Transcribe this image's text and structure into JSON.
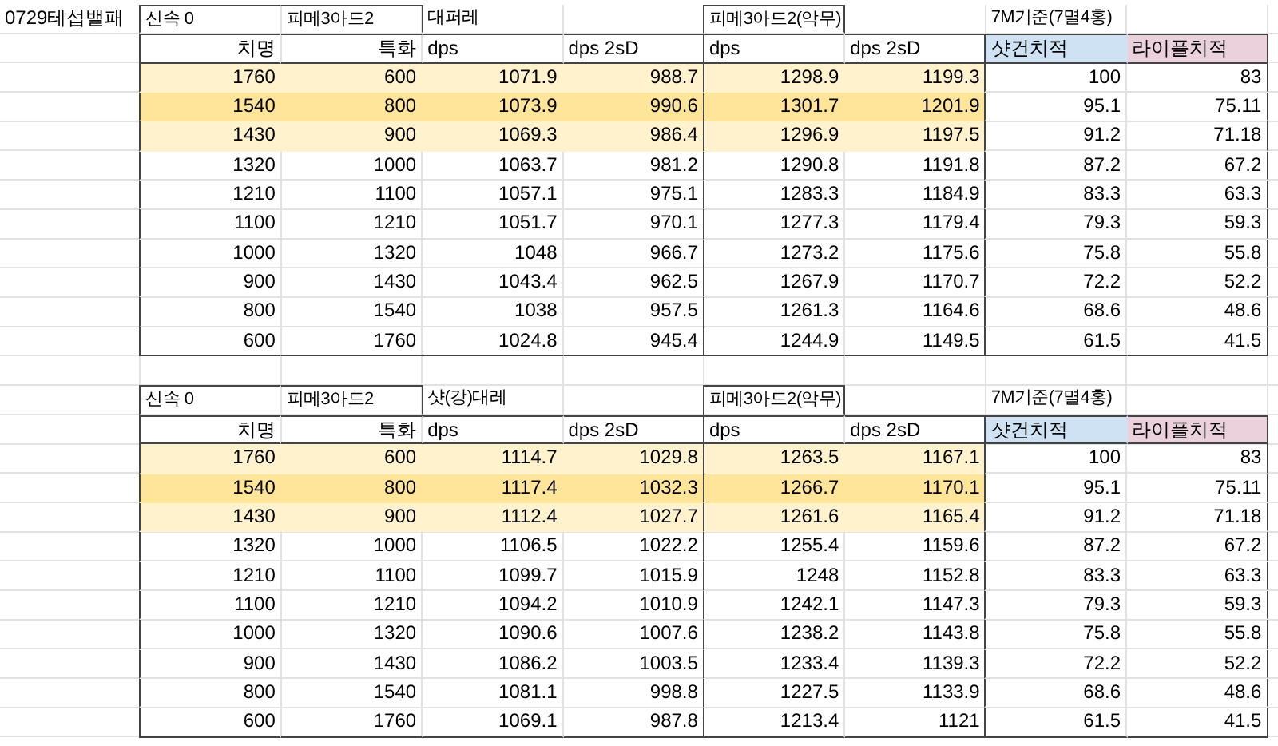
{
  "sheet_title": "0729테섭밸패",
  "tables": [
    {
      "columns": [
        {
          "label": "치명",
          "kind": "stat",
          "group": "신속 0"
        },
        {
          "label": "특화",
          "kind": "stat",
          "group": "피메3아드2"
        },
        {
          "label": "dps",
          "kind": "value",
          "group": "대퍼레"
        },
        {
          "label": "dps 2sD",
          "kind": "value"
        },
        {
          "label": "dps",
          "kind": "value",
          "group": "피메3아드2(악무)"
        },
        {
          "label": "dps 2sD",
          "kind": "value"
        },
        {
          "label": "샷건치적",
          "kind": "value",
          "group": "7M기준(7멸4홍)",
          "color": "#cfe2f3"
        },
        {
          "label": "라이플치적",
          "kind": "value",
          "color": "#ead1dc"
        }
      ],
      "rows": [
        {
          "color": "#fff2cc",
          "cells": [
            "1760",
            "600",
            "1071.9",
            "988.7",
            "1298.9",
            "1199.3",
            "100",
            "83"
          ]
        },
        {
          "color": "#ffe599",
          "cells": [
            "1540",
            "800",
            "1073.9",
            "990.6",
            "1301.7",
            "1201.9",
            "95.1",
            "75.11"
          ]
        },
        {
          "color": "#fff2cc",
          "cells": [
            "1430",
            "900",
            "1069.3",
            "986.4",
            "1296.9",
            "1197.5",
            "91.2",
            "71.18"
          ]
        },
        {
          "cells": [
            "1320",
            "1000",
            "1063.7",
            "981.2",
            "1290.8",
            "1191.8",
            "87.2",
            "67.2"
          ]
        },
        {
          "cells": [
            "1210",
            "1100",
            "1057.1",
            "975.1",
            "1283.3",
            "1184.9",
            "83.3",
            "63.3"
          ]
        },
        {
          "cells": [
            "1100",
            "1210",
            "1051.7",
            "970.1",
            "1277.3",
            "1179.4",
            "79.3",
            "59.3"
          ]
        },
        {
          "cells": [
            "1000",
            "1320",
            "1048",
            "966.7",
            "1273.2",
            "1175.6",
            "75.8",
            "55.8"
          ]
        },
        {
          "cells": [
            "900",
            "1430",
            "1043.4",
            "962.5",
            "1267.9",
            "1170.7",
            "72.2",
            "52.2"
          ]
        },
        {
          "cells": [
            "800",
            "1540",
            "1038",
            "957.5",
            "1261.3",
            "1164.6",
            "68.6",
            "48.6"
          ]
        },
        {
          "cells": [
            "600",
            "1760",
            "1024.8",
            "945.4",
            "1244.9",
            "1149.5",
            "61.5",
            "41.5"
          ]
        }
      ]
    },
    {
      "columns": [
        {
          "label": "치명",
          "kind": "stat",
          "group": "신속 0"
        },
        {
          "label": "특화",
          "kind": "stat",
          "group": "피메3아드2"
        },
        {
          "label": "dps",
          "kind": "value",
          "group": "샷(강)대레"
        },
        {
          "label": "dps 2sD",
          "kind": "value"
        },
        {
          "label": "dps",
          "kind": "value",
          "group": "피메3아드2(악무)"
        },
        {
          "label": "dps 2sD",
          "kind": "value"
        },
        {
          "label": "샷건치적",
          "kind": "value",
          "group": "7M기준(7멸4홍)",
          "color": "#cfe2f3"
        },
        {
          "label": "라이플치적",
          "kind": "value",
          "color": "#ead1dc"
        }
      ],
      "rows": [
        {
          "color": "#fff2cc",
          "cells": [
            "1760",
            "600",
            "1114.7",
            "1029.8",
            "1263.5",
            "1167.1",
            "100",
            "83"
          ]
        },
        {
          "color": "#ffe599",
          "cells": [
            "1540",
            "800",
            "1117.4",
            "1032.3",
            "1266.7",
            "1170.1",
            "95.1",
            "75.11"
          ]
        },
        {
          "color": "#fff2cc",
          "cells": [
            "1430",
            "900",
            "1112.4",
            "1027.7",
            "1261.6",
            "1165.4",
            "91.2",
            "71.18"
          ]
        },
        {
          "cells": [
            "1320",
            "1000",
            "1106.5",
            "1022.2",
            "1255.4",
            "1159.6",
            "87.2",
            "67.2"
          ]
        },
        {
          "cells": [
            "1210",
            "1100",
            "1099.7",
            "1015.9",
            "1248",
            "1152.8",
            "83.3",
            "63.3"
          ]
        },
        {
          "cells": [
            "1100",
            "1210",
            "1094.2",
            "1010.9",
            "1242.1",
            "1147.3",
            "79.3",
            "59.3"
          ]
        },
        {
          "cells": [
            "1000",
            "1320",
            "1090.6",
            "1007.6",
            "1238.2",
            "1143.8",
            "75.8",
            "55.8"
          ]
        },
        {
          "cells": [
            "900",
            "1430",
            "1086.2",
            "1003.5",
            "1233.4",
            "1139.3",
            "72.2",
            "52.2"
          ]
        },
        {
          "cells": [
            "800",
            "1540",
            "1081.1",
            "998.8",
            "1227.5",
            "1133.9",
            "68.6",
            "48.6"
          ]
        },
        {
          "cells": [
            "600",
            "1760",
            "1069.1",
            "987.8",
            "1213.4",
            "1121",
            "61.5",
            "41.5"
          ]
        }
      ]
    }
  ]
}
